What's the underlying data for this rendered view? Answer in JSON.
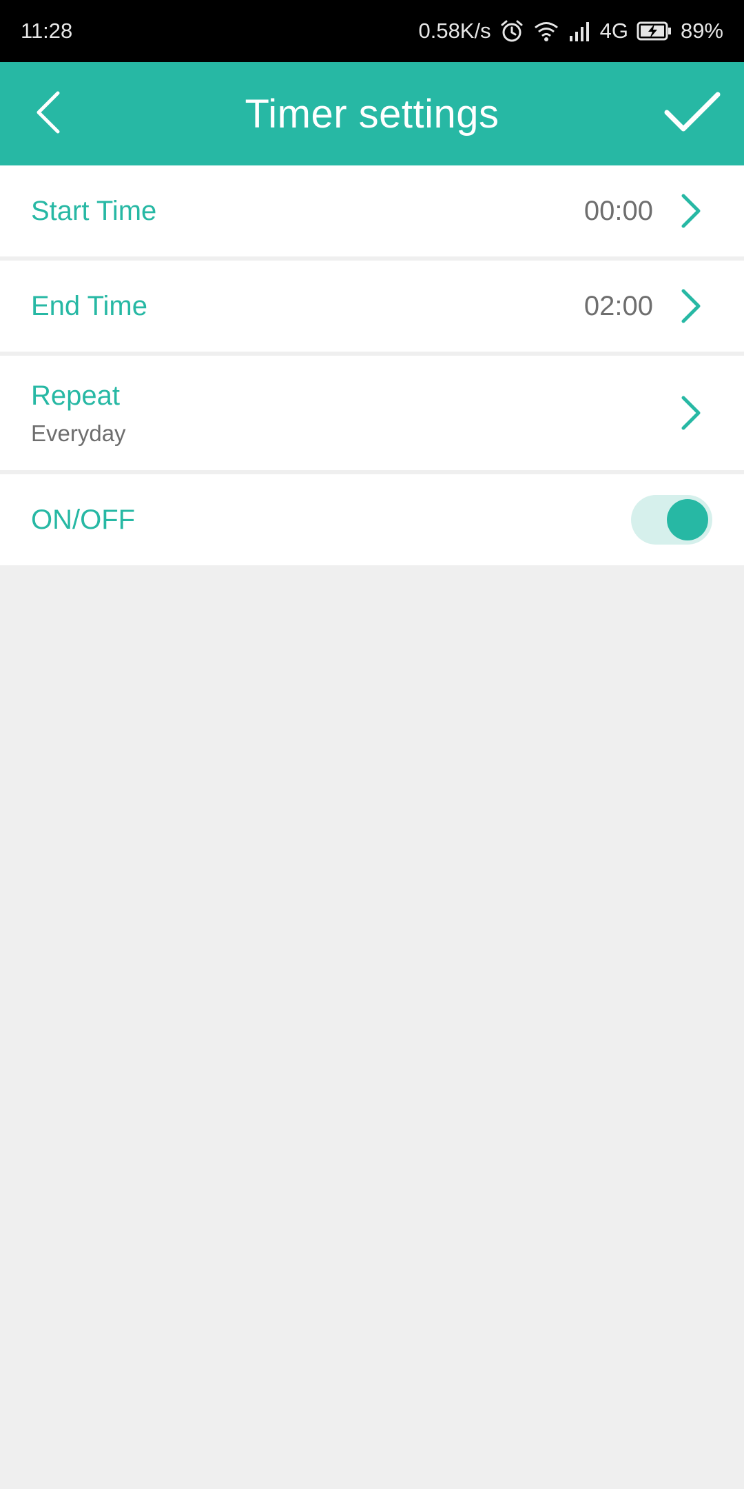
{
  "status_bar": {
    "time": "11:28",
    "net_speed": "0.58K/s",
    "network": "4G",
    "battery": "89%",
    "icons": [
      "alarm-icon",
      "wifi-icon",
      "signal-icon",
      "battery-charging-icon"
    ]
  },
  "app_bar": {
    "title": "Timer settings",
    "back_icon": "back-chevron-icon",
    "confirm_icon": "checkmark-icon"
  },
  "settings": {
    "start_time": {
      "label": "Start Time",
      "value": "00:00"
    },
    "end_time": {
      "label": "End Time",
      "value": "02:00"
    },
    "repeat": {
      "label": "Repeat",
      "value": "Everyday"
    },
    "on_off": {
      "label": "ON/OFF",
      "enabled": true
    }
  },
  "colors": {
    "accent": "#27b8a4",
    "background": "#efefef",
    "value_text": "#6e6e6e"
  }
}
